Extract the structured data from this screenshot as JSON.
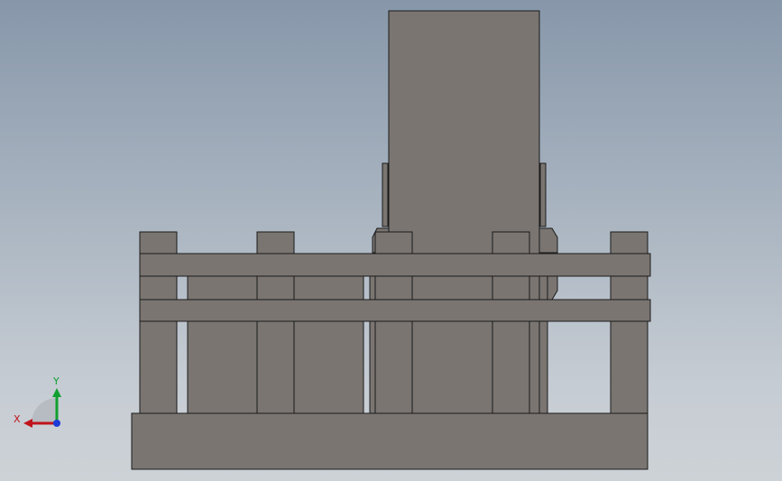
{
  "view": {
    "background_top": "#8797aa",
    "background_bottom": "#cdd2d7",
    "part_fill": "#7a7571",
    "edge_color": "#1a1a1a"
  },
  "triad": {
    "x_label": "X",
    "y_label": "Y",
    "x_color": "#c0141c",
    "y_color": "#10a030",
    "z_color": "#1c3ad8",
    "x_label_color": "#c0141c",
    "y_label_color": "#10a030"
  }
}
